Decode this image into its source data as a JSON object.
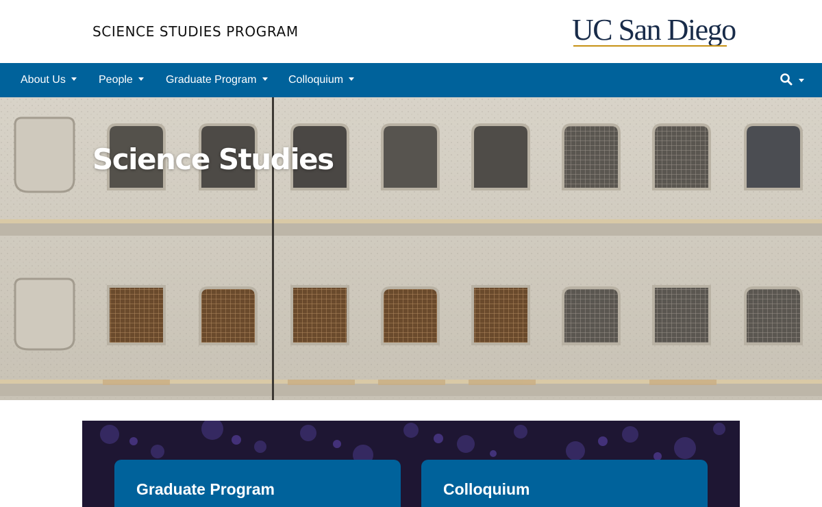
{
  "header": {
    "program_name": "SCIENCE STUDIES PROGRAM",
    "logo_text": "UC San Diego"
  },
  "nav": {
    "items": [
      {
        "label": "About Us"
      },
      {
        "label": "People"
      },
      {
        "label": "Graduate Program"
      },
      {
        "label": "Colloquium"
      }
    ],
    "search_icon": "search-icon"
  },
  "hero": {
    "title": "Science Studies"
  },
  "cards": [
    {
      "title": "Graduate Program"
    },
    {
      "title": "Colloquium"
    }
  ],
  "colors": {
    "nav_blue": "#00629b",
    "navy": "#182b49",
    "gold": "#c69214",
    "concrete": "#d2cdc2"
  }
}
